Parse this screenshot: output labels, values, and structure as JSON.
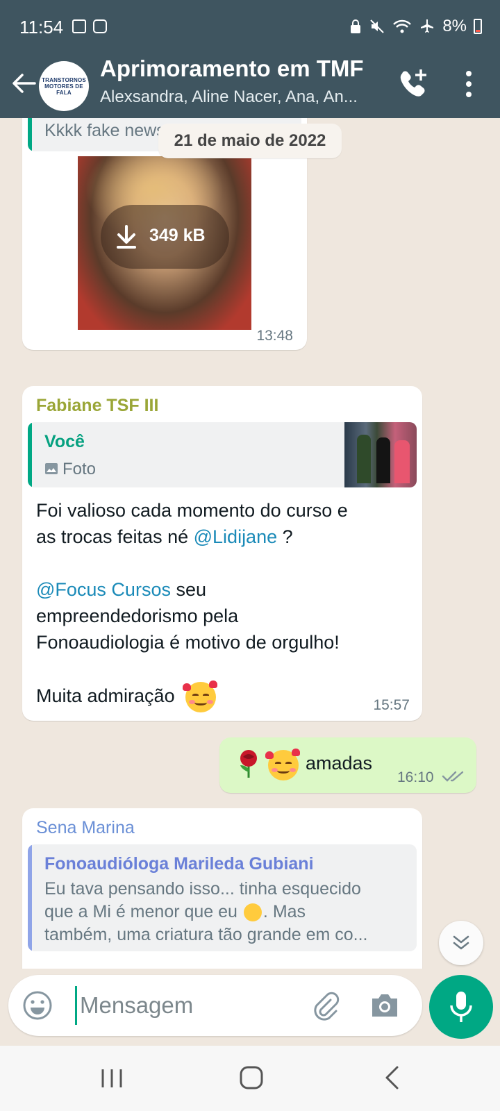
{
  "status_bar": {
    "time": "11:54",
    "battery": "8%"
  },
  "header": {
    "title": "Aprimoramento em TMF",
    "subtitle": "Alexsandra, Aline Nacer, Ana, An...",
    "avatar_text": "TRANSTORNOS MOTORES DE FALA"
  },
  "chat": {
    "date_separator": "21 de maio de 2022",
    "msg1": {
      "quote_text": "Kkkk fake news",
      "image_size": "349 kB",
      "time": "13:48"
    },
    "msg2": {
      "sender": "Fabiane TSF III",
      "quote_sender": "Você",
      "quote_type": "Foto",
      "line1": "Foi valioso cada momento do curso e",
      "line2_prefix": "as trocas feitas né ",
      "mention1": "@Lidijane",
      "line2_suffix": " ?",
      "mention2": "@Focus Cursos",
      "line3_suffix": " seu",
      "line4": "empreendedorismo pela",
      "line5": "Fonoaudiologia é  motivo de orgulho!",
      "line6": "Muita admiração",
      "time": "15:57"
    },
    "msg3": {
      "text": "amadas",
      "time": "16:10"
    },
    "msg4": {
      "sender": "Sena Marina",
      "quote_sender": "Fonoaudióloga Marileda Gubiani",
      "quote_line1": "Eu tava pensando isso... tinha esquecido",
      "quote_line2": "que a Mi é menor que eu",
      "quote_line2_suffix": ". Mas",
      "quote_line3": "também, uma criatura tão grande em co..."
    }
  },
  "input": {
    "placeholder": "Mensagem"
  },
  "colors": {
    "header": "#3f5560",
    "accent": "#00a884",
    "outgoing": "#dcf8c6",
    "sender1": "#9aa637",
    "sender2": "#6a8fd6"
  }
}
